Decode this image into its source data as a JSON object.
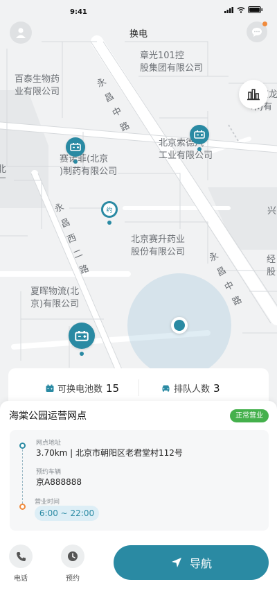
{
  "status_bar": {
    "time": "9:41"
  },
  "header": {
    "title": "换电"
  },
  "map": {
    "labels": {
      "pois": [
        "百泰生物药\n业有限公司",
        "章光101控\n股集团有限公司",
        "赛诺菲(北京\n)制药有限公司",
        "北京索德汽\n工业有限公司",
        "北京赛升药业\n股份有限公司",
        "夏晖物流(北\n京)有限公司",
        "北京龙\n术)有",
        "北\n厂",
        "兴",
        "经\n股"
      ],
      "roads": [
        "永昌中路",
        "永昌西二路",
        "永昌中路"
      ]
    },
    "reserved_pin_label": "约"
  },
  "stats": {
    "battery_label": "可换电池数",
    "battery_count": "15",
    "queue_label": "排队人数",
    "queue_count": "3"
  },
  "station": {
    "name": "海棠公园运营网点",
    "status": "正常营业",
    "address_label": "网点地址",
    "address": "3.70km | 北京市朝阳区老君堂村112号",
    "vehicle_label": "预约车辆",
    "vehicle": "京A888888",
    "hours_label": "营业时间",
    "hours": "6:00 ~ 22:00"
  },
  "actions": {
    "phone_label": "电话",
    "reserve_label": "预约",
    "navigate_label": "导航"
  },
  "colors": {
    "accent": "#2a8aa3",
    "open_badge": "#44b04c",
    "notification_dot": "#f08a3c"
  },
  "icons": [
    "user-icon",
    "message-icon",
    "bar-chart-icon",
    "battery-pin-icon",
    "phone-icon",
    "clock-icon",
    "navigate-arrow-icon",
    "car-icon"
  ]
}
